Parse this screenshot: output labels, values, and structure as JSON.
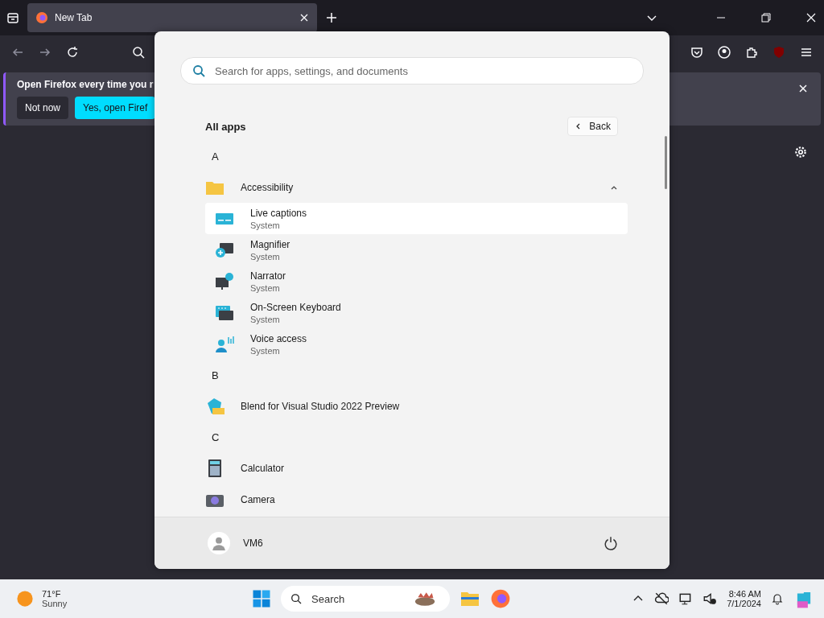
{
  "browser": {
    "tab": {
      "title": "New Tab"
    },
    "notification": {
      "message": "Open Firefox every time you r",
      "buttons": [
        {
          "label": "Not now",
          "kind": "secondary"
        },
        {
          "label": "Yes, open Firef",
          "kind": "primary"
        }
      ]
    }
  },
  "start_menu": {
    "search": {
      "placeholder": "Search for apps, settings, and documents"
    },
    "title": "All apps",
    "back_button": "Back",
    "sections": [
      {
        "letter": "A",
        "items": [
          {
            "kind": "folder",
            "name": "Accessibility",
            "expanded": true,
            "children": [
              {
                "name": "Live captions",
                "subtitle": "System",
                "selected": true
              },
              {
                "name": "Magnifier",
                "subtitle": "System",
                "selected": false
              },
              {
                "name": "Narrator",
                "subtitle": "System",
                "selected": false
              },
              {
                "name": "On-Screen Keyboard",
                "subtitle": "System",
                "selected": false
              },
              {
                "name": "Voice access",
                "subtitle": "System",
                "selected": false
              }
            ]
          }
        ]
      },
      {
        "letter": "B",
        "items": [
          {
            "kind": "app",
            "name": "Blend for Visual Studio 2022 Preview"
          }
        ]
      },
      {
        "letter": "C",
        "items": [
          {
            "kind": "app",
            "name": "Calculator"
          },
          {
            "kind": "app",
            "name": "Camera"
          }
        ]
      }
    ],
    "user": {
      "name": "VM6"
    }
  },
  "taskbar": {
    "weather": {
      "temperature": "71°F",
      "condition": "Sunny"
    },
    "search": {
      "placeholder": "Search"
    },
    "clock": {
      "time": "8:46 AM",
      "date": "7/1/2024"
    }
  }
}
